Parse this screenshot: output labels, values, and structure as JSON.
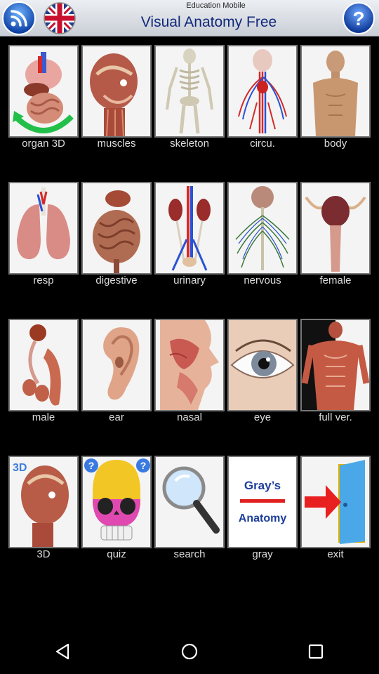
{
  "header": {
    "publisher": "Education Mobile",
    "title": "Visual Anatomy Free",
    "wifi_icon": "wifi-icon",
    "flag_icon": "uk-flag-icon",
    "help_icon": "help-icon"
  },
  "tiles": [
    {
      "label": "organ 3D",
      "icon": "organs-icon"
    },
    {
      "label": "muscles",
      "icon": "head-muscles-icon"
    },
    {
      "label": "skeleton",
      "icon": "skeleton-icon"
    },
    {
      "label": "circu.",
      "icon": "circulatory-icon"
    },
    {
      "label": "body",
      "icon": "body-icon"
    },
    {
      "label": "resp",
      "icon": "lungs-icon"
    },
    {
      "label": "digestive",
      "icon": "digestive-icon"
    },
    {
      "label": "urinary",
      "icon": "kidneys-icon"
    },
    {
      "label": "nervous",
      "icon": "nervous-icon"
    },
    {
      "label": "female",
      "icon": "female-icon"
    },
    {
      "label": "male",
      "icon": "male-icon"
    },
    {
      "label": "ear",
      "icon": "ear-icon"
    },
    {
      "label": "nasal",
      "icon": "nasal-icon"
    },
    {
      "label": "eye",
      "icon": "eye-icon"
    },
    {
      "label": "full ver.",
      "icon": "full-body-muscles-icon"
    },
    {
      "label": "3D",
      "icon": "3d-head-icon",
      "badge": "3D"
    },
    {
      "label": "quiz",
      "icon": "skull-quiz-icon"
    },
    {
      "label": "search",
      "icon": "magnifier-icon"
    },
    {
      "label": "gray",
      "icon": "grays-anatomy-icon",
      "line1": "Gray’s",
      "line2": "Anatomy"
    },
    {
      "label": "exit",
      "icon": "exit-door-icon"
    }
  ],
  "navbar": {
    "back_icon": "back-icon",
    "home_icon": "home-icon",
    "recents_icon": "recents-icon"
  },
  "colors": {
    "header_title": "#12297a",
    "label": "#dddddd",
    "background": "#000000",
    "accent_red": "#e02020"
  }
}
